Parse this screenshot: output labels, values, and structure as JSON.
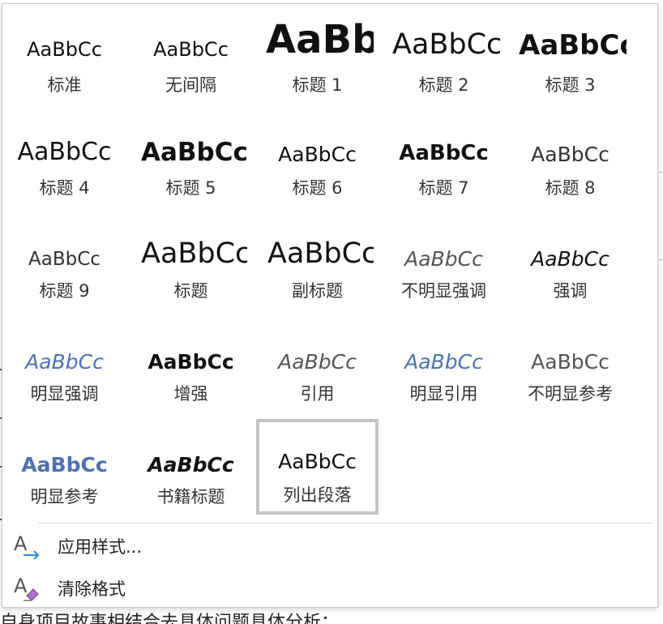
{
  "styles_gallery": {
    "sample_text": "AaBbCc",
    "items": [
      {
        "name": "标准"
      },
      {
        "name": "无间隔"
      },
      {
        "name": "标题 1"
      },
      {
        "name": "标题 2"
      },
      {
        "name": "标题 3"
      },
      {
        "name": "标题 4"
      },
      {
        "name": "标题 5"
      },
      {
        "name": "标题 6"
      },
      {
        "name": "标题 7"
      },
      {
        "name": "标题 8"
      },
      {
        "name": "标题 9"
      },
      {
        "name": "标题"
      },
      {
        "name": "副标题"
      },
      {
        "name": "不明显强调"
      },
      {
        "name": "强调"
      },
      {
        "name": "明显强调"
      },
      {
        "name": "增强"
      },
      {
        "name": "引用"
      },
      {
        "name": "明显引用"
      },
      {
        "name": "不明显参考"
      },
      {
        "name": "明显参考"
      },
      {
        "name": "书籍标题"
      },
      {
        "name": "列出段落",
        "selected": true
      }
    ]
  },
  "menu": {
    "apply_styles": "应用样式...",
    "clear_formatting": "清除格式"
  },
  "background_document": {
    "partial_line": "自身项目故事相结合去具体问题具体分析："
  },
  "colors": {
    "accent_blue": "#4a72b8",
    "selected_border": "#c4c4c4",
    "icon_arrow": "#2b88d8",
    "icon_eraser": "#b36bd0"
  }
}
